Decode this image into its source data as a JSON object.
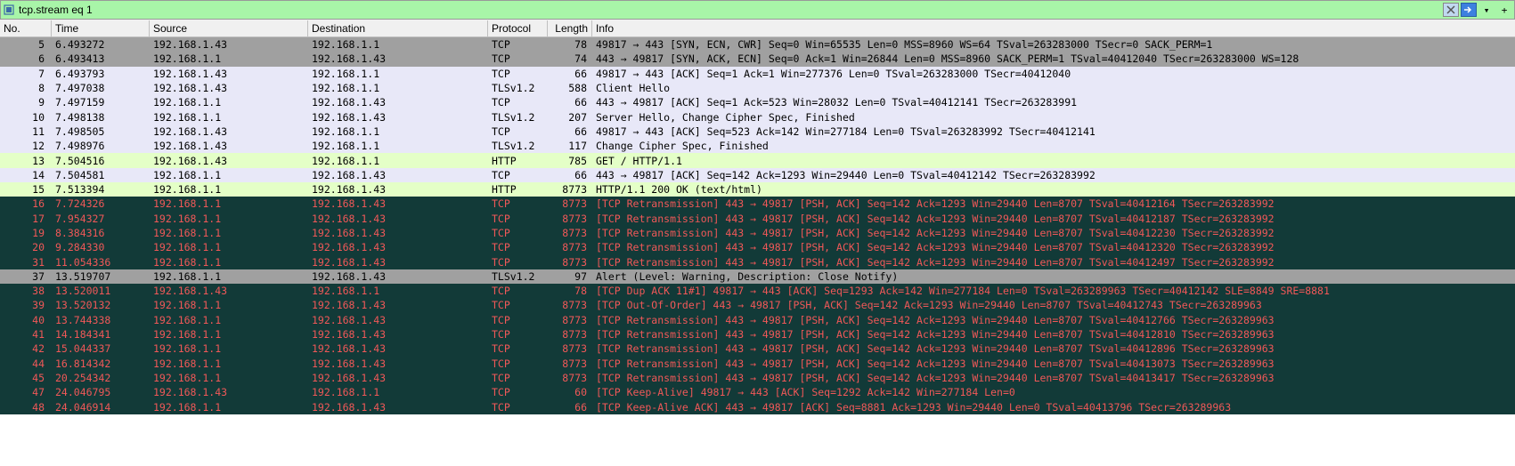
{
  "filter": {
    "value": "tcp.stream eq 1"
  },
  "headers": {
    "no": "No.",
    "time": "Time",
    "source": "Source",
    "destination": "Destination",
    "protocol": "Protocol",
    "length": "Length",
    "info": "Info"
  },
  "rows": [
    {
      "no": "5",
      "time": "6.493272",
      "src": "192.168.1.43",
      "dst": "192.168.1.1",
      "proto": "TCP",
      "len": "78",
      "info": "49817 → 443 [SYN, ECN, CWR] Seq=0 Win=65535 Len=0 MSS=8960 WS=64 TSval=263283000 TSecr=0 SACK_PERM=1",
      "cls": "c-gray"
    },
    {
      "no": "6",
      "time": "6.493413",
      "src": "192.168.1.1",
      "dst": "192.168.1.43",
      "proto": "TCP",
      "len": "74",
      "info": "443 → 49817 [SYN, ACK, ECN] Seq=0 Ack=1 Win=26844 Len=0 MSS=8960 SACK_PERM=1 TSval=40412040 TSecr=263283000 WS=128",
      "cls": "c-gray"
    },
    {
      "no": "7",
      "time": "6.493793",
      "src": "192.168.1.43",
      "dst": "192.168.1.1",
      "proto": "TCP",
      "len": "66",
      "info": "49817 → 443 [ACK] Seq=1 Ack=1 Win=277376 Len=0 TSval=263283000 TSecr=40412040",
      "cls": "c-light"
    },
    {
      "no": "8",
      "time": "7.497038",
      "src": "192.168.1.43",
      "dst": "192.168.1.1",
      "proto": "TLSv1.2",
      "len": "588",
      "info": "Client Hello",
      "cls": "c-light"
    },
    {
      "no": "9",
      "time": "7.497159",
      "src": "192.168.1.1",
      "dst": "192.168.1.43",
      "proto": "TCP",
      "len": "66",
      "info": "443 → 49817 [ACK] Seq=1 Ack=523 Win=28032 Len=0 TSval=40412141 TSecr=263283991",
      "cls": "c-light"
    },
    {
      "no": "10",
      "time": "7.498138",
      "src": "192.168.1.1",
      "dst": "192.168.1.43",
      "proto": "TLSv1.2",
      "len": "207",
      "info": "Server Hello, Change Cipher Spec, Finished",
      "cls": "c-light"
    },
    {
      "no": "11",
      "time": "7.498505",
      "src": "192.168.1.43",
      "dst": "192.168.1.1",
      "proto": "TCP",
      "len": "66",
      "info": "49817 → 443 [ACK] Seq=523 Ack=142 Win=277184 Len=0 TSval=263283992 TSecr=40412141",
      "cls": "c-light"
    },
    {
      "no": "12",
      "time": "7.498976",
      "src": "192.168.1.43",
      "dst": "192.168.1.1",
      "proto": "TLSv1.2",
      "len": "117",
      "info": "Change Cipher Spec, Finished",
      "cls": "c-light"
    },
    {
      "no": "13",
      "time": "7.504516",
      "src": "192.168.1.43",
      "dst": "192.168.1.1",
      "proto": "HTTP",
      "len": "785",
      "info": "GET / HTTP/1.1",
      "cls": "c-green"
    },
    {
      "no": "14",
      "time": "7.504581",
      "src": "192.168.1.1",
      "dst": "192.168.1.43",
      "proto": "TCP",
      "len": "66",
      "info": "443 → 49817 [ACK] Seq=142 Ack=1293 Win=29440 Len=0 TSval=40412142 TSecr=263283992",
      "cls": "c-light"
    },
    {
      "no": "15",
      "time": "7.513394",
      "src": "192.168.1.1",
      "dst": "192.168.1.43",
      "proto": "HTTP",
      "len": "8773",
      "info": "HTTP/1.1 200 OK  (text/html)",
      "cls": "c-green"
    },
    {
      "no": "16",
      "time": "7.724326",
      "src": "192.168.1.1",
      "dst": "192.168.1.43",
      "proto": "TCP",
      "len": "8773",
      "info": "[TCP Retransmission] 443 → 49817 [PSH, ACK] Seq=142 Ack=1293 Win=29440 Len=8707 TSval=40412164 TSecr=263283992",
      "cls": "c-dark"
    },
    {
      "no": "17",
      "time": "7.954327",
      "src": "192.168.1.1",
      "dst": "192.168.1.43",
      "proto": "TCP",
      "len": "8773",
      "info": "[TCP Retransmission] 443 → 49817 [PSH, ACK] Seq=142 Ack=1293 Win=29440 Len=8707 TSval=40412187 TSecr=263283992",
      "cls": "c-dark"
    },
    {
      "no": "19",
      "time": "8.384316",
      "src": "192.168.1.1",
      "dst": "192.168.1.43",
      "proto": "TCP",
      "len": "8773",
      "info": "[TCP Retransmission] 443 → 49817 [PSH, ACK] Seq=142 Ack=1293 Win=29440 Len=8707 TSval=40412230 TSecr=263283992",
      "cls": "c-dark"
    },
    {
      "no": "20",
      "time": "9.284330",
      "src": "192.168.1.1",
      "dst": "192.168.1.43",
      "proto": "TCP",
      "len": "8773",
      "info": "[TCP Retransmission] 443 → 49817 [PSH, ACK] Seq=142 Ack=1293 Win=29440 Len=8707 TSval=40412320 TSecr=263283992",
      "cls": "c-dark"
    },
    {
      "no": "31",
      "time": "11.054336",
      "src": "192.168.1.1",
      "dst": "192.168.1.43",
      "proto": "TCP",
      "len": "8773",
      "info": "[TCP Retransmission] 443 → 49817 [PSH, ACK] Seq=142 Ack=1293 Win=29440 Len=8707 TSval=40412497 TSecr=263283992",
      "cls": "c-dark"
    },
    {
      "no": "37",
      "time": "13.519707",
      "src": "192.168.1.1",
      "dst": "192.168.1.43",
      "proto": "TLSv1.2",
      "len": "97",
      "info": "Alert (Level: Warning, Description: Close Notify)",
      "cls": "c-gray"
    },
    {
      "no": "38",
      "time": "13.520011",
      "src": "192.168.1.43",
      "dst": "192.168.1.1",
      "proto": "TCP",
      "len": "78",
      "info": "[TCP Dup ACK 11#1] 49817 → 443 [ACK] Seq=1293 Ack=142 Win=277184 Len=0 TSval=263289963 TSecr=40412142 SLE=8849 SRE=8881",
      "cls": "c-dark"
    },
    {
      "no": "39",
      "time": "13.520132",
      "src": "192.168.1.1",
      "dst": "192.168.1.43",
      "proto": "TCP",
      "len": "8773",
      "info": "[TCP Out-Of-Order] 443 → 49817 [PSH, ACK] Seq=142 Ack=1293 Win=29440 Len=8707 TSval=40412743 TSecr=263289963",
      "cls": "c-dark"
    },
    {
      "no": "40",
      "time": "13.744338",
      "src": "192.168.1.1",
      "dst": "192.168.1.43",
      "proto": "TCP",
      "len": "8773",
      "info": "[TCP Retransmission] 443 → 49817 [PSH, ACK] Seq=142 Ack=1293 Win=29440 Len=8707 TSval=40412766 TSecr=263289963",
      "cls": "c-dark"
    },
    {
      "no": "41",
      "time": "14.184341",
      "src": "192.168.1.1",
      "dst": "192.168.1.43",
      "proto": "TCP",
      "len": "8773",
      "info": "[TCP Retransmission] 443 → 49817 [PSH, ACK] Seq=142 Ack=1293 Win=29440 Len=8707 TSval=40412810 TSecr=263289963",
      "cls": "c-dark"
    },
    {
      "no": "42",
      "time": "15.044337",
      "src": "192.168.1.1",
      "dst": "192.168.1.43",
      "proto": "TCP",
      "len": "8773",
      "info": "[TCP Retransmission] 443 → 49817 [PSH, ACK] Seq=142 Ack=1293 Win=29440 Len=8707 TSval=40412896 TSecr=263289963",
      "cls": "c-dark"
    },
    {
      "no": "44",
      "time": "16.814342",
      "src": "192.168.1.1",
      "dst": "192.168.1.43",
      "proto": "TCP",
      "len": "8773",
      "info": "[TCP Retransmission] 443 → 49817 [PSH, ACK] Seq=142 Ack=1293 Win=29440 Len=8707 TSval=40413073 TSecr=263289963",
      "cls": "c-dark"
    },
    {
      "no": "45",
      "time": "20.254342",
      "src": "192.168.1.1",
      "dst": "192.168.1.43",
      "proto": "TCP",
      "len": "8773",
      "info": "[TCP Retransmission] 443 → 49817 [PSH, ACK] Seq=142 Ack=1293 Win=29440 Len=8707 TSval=40413417 TSecr=263289963",
      "cls": "c-dark"
    },
    {
      "no": "47",
      "time": "24.046795",
      "src": "192.168.1.43",
      "dst": "192.168.1.1",
      "proto": "TCP",
      "len": "60",
      "info": "[TCP Keep-Alive] 49817 → 443 [ACK] Seq=1292 Ack=142 Win=277184 Len=0",
      "cls": "c-dark"
    },
    {
      "no": "48",
      "time": "24.046914",
      "src": "192.168.1.1",
      "dst": "192.168.1.43",
      "proto": "TCP",
      "len": "66",
      "info": "[TCP Keep-Alive ACK] 443 → 49817 [ACK] Seq=8881 Ack=1293 Win=29440 Len=0 TSval=40413796 TSecr=263289963",
      "cls": "c-dark"
    }
  ]
}
